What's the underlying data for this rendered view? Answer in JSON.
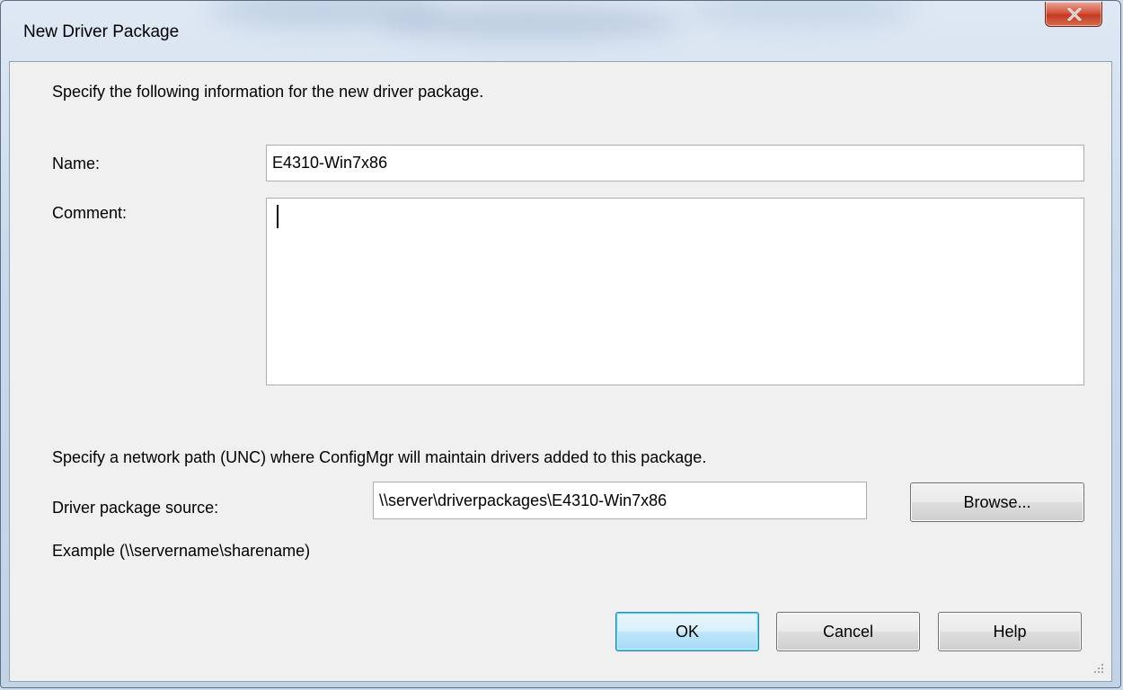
{
  "window": {
    "title": "New Driver Package",
    "close_icon": "close-icon"
  },
  "form": {
    "intro": "Specify the following information for the new driver package.",
    "name_label": "Name:",
    "name_value": "E4310-Win7x86",
    "comment_label": "Comment:",
    "comment_value": "",
    "unc_instruction": "Specify a network path (UNC) where ConfigMgr will maintain drivers added to this package.",
    "source_label": "Driver package source:",
    "source_value": "\\\\server\\driverpackages\\E4310-Win7x86",
    "example": "Example (\\\\servername\\sharename)"
  },
  "buttons": {
    "browse": "Browse...",
    "ok": "OK",
    "cancel": "Cancel",
    "help": "Help"
  },
  "colors": {
    "default_button_border": "#3c7fb1",
    "close_button": "#c23a23"
  }
}
